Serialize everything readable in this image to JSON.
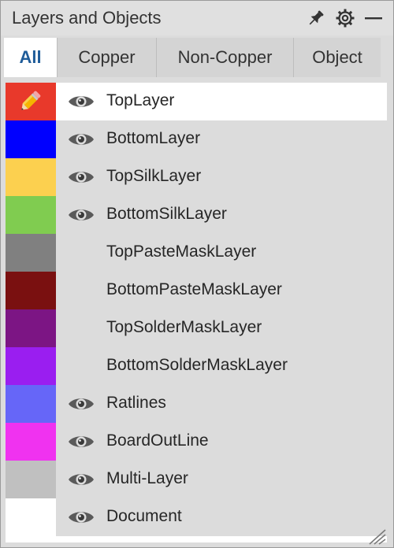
{
  "panel": {
    "title": "Layers and Objects",
    "icons": [
      "pin-icon",
      "gear-icon",
      "minimize-icon"
    ]
  },
  "tabs": [
    {
      "label": "All",
      "active": true
    },
    {
      "label": "Copper",
      "active": false
    },
    {
      "label": "Non-Copper",
      "active": false
    },
    {
      "label": "Object",
      "active": false
    }
  ],
  "layers": [
    {
      "name": "TopLayer",
      "color": "#e8392b",
      "visible": true,
      "selected": true,
      "icon": "pencil-icon"
    },
    {
      "name": "BottomLayer",
      "color": "#0000ff",
      "visible": true,
      "selected": false
    },
    {
      "name": "TopSilkLayer",
      "color": "#fcd04f",
      "visible": true,
      "selected": false
    },
    {
      "name": "BottomSilkLayer",
      "color": "#80cc50",
      "visible": true,
      "selected": false
    },
    {
      "name": "TopPasteMaskLayer",
      "color": "#808080",
      "visible": false,
      "selected": false
    },
    {
      "name": "BottomPasteMaskLayer",
      "color": "#7a1010",
      "visible": false,
      "selected": false
    },
    {
      "name": "TopSolderMaskLayer",
      "color": "#7c1584",
      "visible": false,
      "selected": false
    },
    {
      "name": "BottomSolderMaskLayer",
      "color": "#9a1ef0",
      "visible": false,
      "selected": false
    },
    {
      "name": "Ratlines",
      "color": "#6666f8",
      "visible": true,
      "selected": false
    },
    {
      "name": "BoardOutLine",
      "color": "#f032f0",
      "visible": true,
      "selected": false
    },
    {
      "name": "Multi-Layer",
      "color": "#c0c0c0",
      "visible": true,
      "selected": false
    },
    {
      "name": "Document",
      "color": "#ffffff",
      "visible": true,
      "selected": false
    }
  ]
}
